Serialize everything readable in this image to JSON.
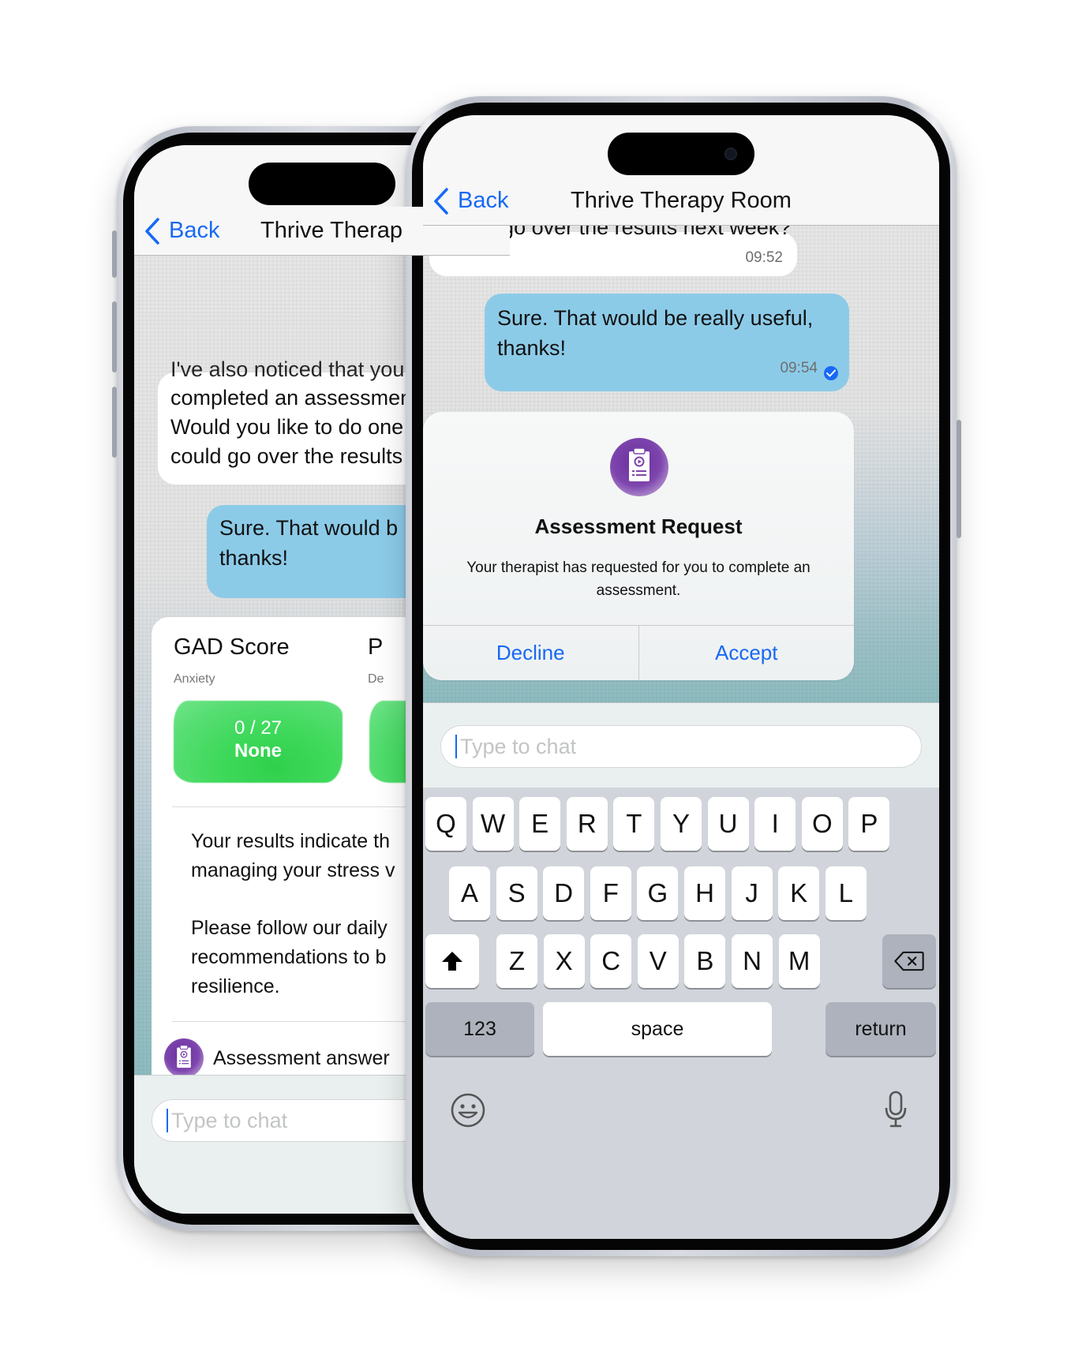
{
  "back_phone": {
    "nav": {
      "back_label": "Back",
      "title": "Thrive Therap"
    },
    "messages": [
      {
        "type": "incoming",
        "cut_line": "I've also noticed that you",
        "lines": [
          "completed an assessmen",
          "Would you like to do one",
          "could go over the results"
        ]
      },
      {
        "type": "outgoing",
        "lines": [
          "Sure. That would b",
          "thanks!"
        ]
      }
    ],
    "score_card": {
      "scores": [
        {
          "title": "GAD Score",
          "subtitle": "Anxiety",
          "value": "0 / 27",
          "level": "None",
          "color": "#3fd95b"
        },
        {
          "title": "P",
          "subtitle": "De"
        }
      ],
      "paragraphs": [
        "Your results indicate th managing your stress v",
        "Please follow our daily recommendations to bu resilience."
      ],
      "paragraph_lines": [
        [
          "Your results indicate th",
          "managing your stress v"
        ],
        [
          "Please follow our daily",
          "recommendations to b",
          "resilience."
        ]
      ],
      "footer_label": "Assessment answer"
    },
    "composer": {
      "placeholder": "Type to chat"
    }
  },
  "front_phone": {
    "nav": {
      "back_label": "Back",
      "title": "Thrive Therapy Room"
    },
    "messages": [
      {
        "type": "incoming",
        "cut_line": "could go over the results next week?",
        "time": "09:52"
      },
      {
        "type": "outgoing",
        "lines": [
          "Sure. That would be really useful,",
          "thanks!"
        ],
        "time": "09:54",
        "status": "read"
      }
    ],
    "alert": {
      "icon": "clipboard-icon",
      "title": "Assessment Request",
      "body": "Your therapist has requested for you to complete an assessment.",
      "decline_label": "Decline",
      "accept_label": "Accept"
    },
    "composer": {
      "placeholder": "Type to chat",
      "value": ""
    },
    "keyboard": {
      "row1": [
        "Q",
        "W",
        "E",
        "R",
        "T",
        "Y",
        "U",
        "I",
        "O",
        "P"
      ],
      "row2": [
        "A",
        "S",
        "D",
        "F",
        "G",
        "H",
        "J",
        "K",
        "L"
      ],
      "row3": [
        "Z",
        "X",
        "C",
        "V",
        "B",
        "N",
        "M"
      ],
      "numbers_label": "123",
      "space_label": "space",
      "return_label": "return"
    }
  },
  "colors": {
    "accent_blue": "#1769f5",
    "outgoing_bubble": "#8ccbe8",
    "score_green": "#3fd95b",
    "assessment_purple": "#7a3fa8"
  }
}
